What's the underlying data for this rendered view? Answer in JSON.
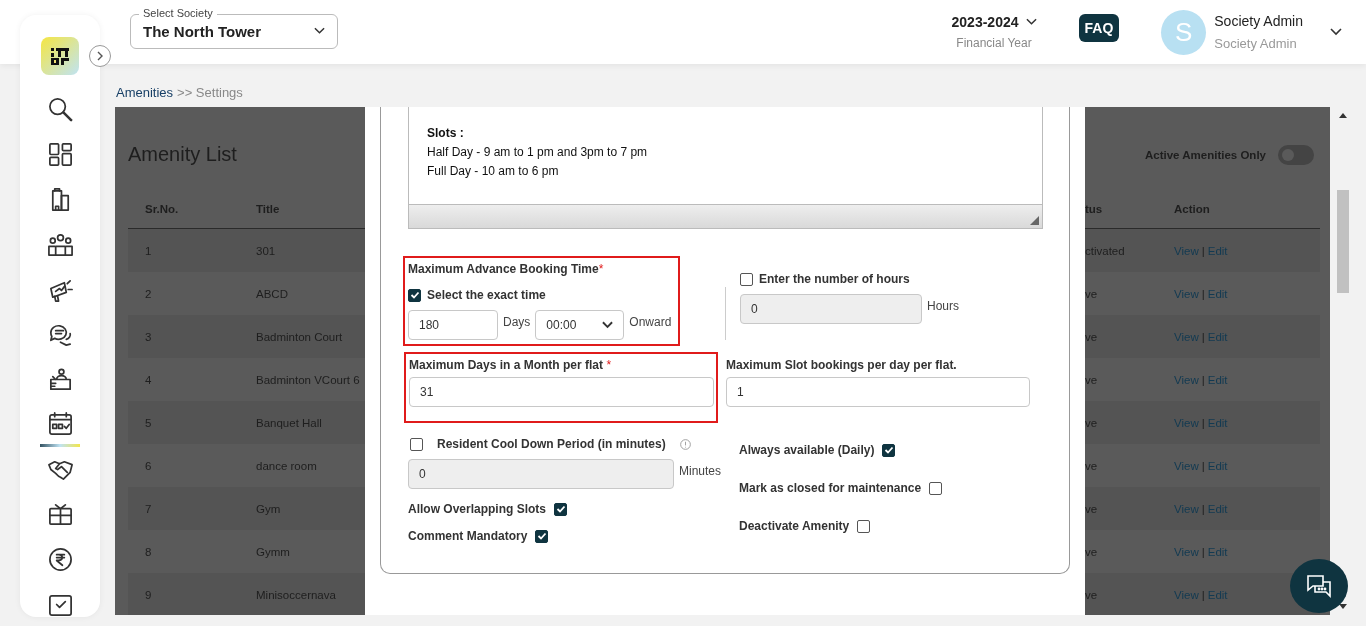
{
  "header": {
    "society_select": {
      "label": "Select Society",
      "value": "The North Tower"
    },
    "financial_year": {
      "value": "2023-2024",
      "caption": "Financial Year"
    },
    "faq": "FAQ",
    "user": {
      "avatar": "S",
      "name": "Society Admin",
      "role": "Society Admin"
    }
  },
  "sidebar": {
    "items": [
      {
        "selected": false
      },
      {
        "selected": false
      },
      {
        "selected": false
      },
      {
        "selected": false
      },
      {
        "selected": false
      },
      {
        "selected": false
      },
      {
        "selected": false
      },
      {
        "selected": true
      },
      {
        "selected": false
      },
      {
        "selected": false
      },
      {
        "selected": false
      },
      {
        "selected": false
      }
    ]
  },
  "breadcrumb": [
    {
      "label": "Amenities",
      "kind": "link"
    },
    {
      "label": ">> Settings",
      "kind": "current"
    }
  ],
  "amenity_list": {
    "title": "Amenity List",
    "filter": {
      "label": "Active Amenities Only",
      "on": false
    },
    "columns": [
      "Sr.No.",
      "Title",
      "tus",
      "Action"
    ],
    "action_separator": "|",
    "rows": [
      {
        "sr": "1",
        "title": "301",
        "status": "ctivated",
        "view": "View",
        "edit": "Edit"
      },
      {
        "sr": "2",
        "title": "ABCD",
        "status": "ve",
        "view": "View",
        "edit": "Edit"
      },
      {
        "sr": "3",
        "title": "Badminton Court",
        "status": "ve",
        "view": "View",
        "edit": "Edit"
      },
      {
        "sr": "4",
        "title": "Badminton VCourt 6",
        "status": "ve",
        "view": "View",
        "edit": "Edit"
      },
      {
        "sr": "5",
        "title": "Banquet Hall",
        "status": "ve",
        "view": "View",
        "edit": "Edit"
      },
      {
        "sr": "6",
        "title": "dance room",
        "status": "ve",
        "view": "View",
        "edit": "Edit"
      },
      {
        "sr": "7",
        "title": "Gym",
        "status": "ve",
        "view": "View",
        "edit": "Edit"
      },
      {
        "sr": "8",
        "title": "Gymm",
        "status": "ve",
        "view": "View",
        "edit": "Edit"
      },
      {
        "sr": "9",
        "title": "Minisoccernava",
        "status": "ve",
        "view": "View",
        "edit": "Edit"
      }
    ]
  },
  "modal": {
    "description": {
      "heading": "Slots :",
      "lines": [
        "Half Day - 9 am to 1 pm and 3pm to 7 pm",
        "Full Day - 10 am to 6 pm"
      ]
    },
    "advance_booking": {
      "title": "Maximum Advance Booking Time",
      "required_mark": "*",
      "highlighted": true,
      "exact_time": {
        "label": "Select the exact time",
        "checked": true,
        "days_value": "180",
        "days_unit": "Days",
        "time_value": "00:00",
        "suffix": "Onward"
      },
      "hours": {
        "label": "Enter the number of hours",
        "checked": false,
        "value": "0",
        "unit": "Hours",
        "disabled": true
      }
    },
    "max_days": {
      "label": "Maximum Days in a Month per flat",
      "required_mark": "*",
      "highlighted": true,
      "value": "31"
    },
    "max_slots": {
      "label": "Maximum Slot bookings per day per flat.",
      "value": "1"
    },
    "cool_down": {
      "label": "Resident Cool Down Period (in minutes)",
      "checked": false,
      "value": "0",
      "unit": "Minutes",
      "disabled": true
    },
    "left_options": [
      {
        "label": "Allow Overlapping Slots",
        "checked": true
      },
      {
        "label": "Comment Mandatory",
        "checked": true
      }
    ],
    "right_options": [
      {
        "label": "Always available (Daily)",
        "checked": true
      },
      {
        "label": "Mark as closed for maintenance",
        "checked": false
      },
      {
        "label": "Deactivate Amenity",
        "checked": false
      }
    ]
  }
}
